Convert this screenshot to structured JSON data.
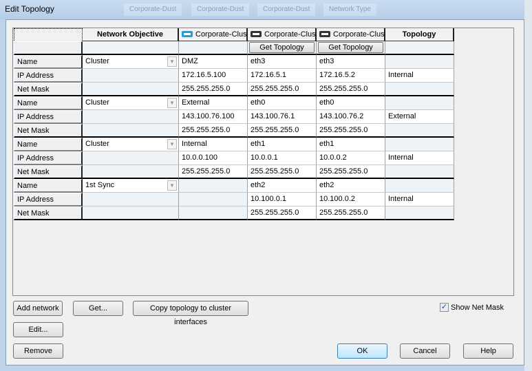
{
  "window": {
    "title": "Edit Topology",
    "background_tabs": [
      "Corporate-Dust",
      "Corporate-Dust",
      "Corporate-Dust",
      "Network Type"
    ]
  },
  "table": {
    "headers": [
      {
        "label": "",
        "icon": ""
      },
      {
        "label": "Network Objective",
        "icon": ""
      },
      {
        "label": "Corporate-Clus",
        "icon": "network-card-icon",
        "icon_color": "#1aa0e0"
      },
      {
        "label": "Corporate-Clus",
        "icon": "network-card-icon",
        "icon_color": "#333333"
      },
      {
        "label": "Corporate-Clus",
        "icon": "network-card-icon",
        "icon_color": "#333333"
      },
      {
        "label": "Topology",
        "icon": ""
      }
    ],
    "get_topology_label": "Get Topology",
    "row_labels": [
      "Name",
      "IP Address",
      "Net Mask"
    ],
    "groups": [
      {
        "objective": "Cluster",
        "name": [
          "DMZ",
          "eth3",
          "eth3"
        ],
        "ip": [
          "172.16.5.100",
          "172.16.5.1",
          "172.16.5.2"
        ],
        "mask": [
          "255.255.255.0",
          "255.255.255.0",
          "255.255.255.0"
        ],
        "topology": "Internal"
      },
      {
        "objective": "Cluster",
        "name": [
          "External",
          "eth0",
          "eth0"
        ],
        "ip": [
          "143.100.76.100",
          "143.100.76.1",
          "143.100.76.2"
        ],
        "mask": [
          "255.255.255.0",
          "255.255.255.0",
          "255.255.255.0"
        ],
        "topology": "External"
      },
      {
        "objective": "Cluster",
        "name": [
          "Internal",
          "eth1",
          "eth1"
        ],
        "ip": [
          "10.0.0.100",
          "10.0.0.1",
          "10.0.0.2"
        ],
        "mask": [
          "255.255.255.0",
          "255.255.255.0",
          "255.255.255.0"
        ],
        "topology": "Internal"
      },
      {
        "objective": "1st Sync",
        "name": [
          "",
          "eth2",
          "eth2"
        ],
        "ip": [
          "",
          "10.100.0.1",
          "10.100.0.2"
        ],
        "mask": [
          "",
          "255.255.255.0",
          "255.255.255.0"
        ],
        "topology": "Internal"
      }
    ]
  },
  "buttons": {
    "add_network": "Add network",
    "get": "Get...",
    "copy_topology": "Copy topology to cluster interfaces",
    "edit": "Edit...",
    "remove": "Remove",
    "ok": "OK",
    "cancel": "Cancel",
    "help": "Help"
  },
  "show_net_mask": {
    "label": "Show Net Mask",
    "checked": true
  }
}
